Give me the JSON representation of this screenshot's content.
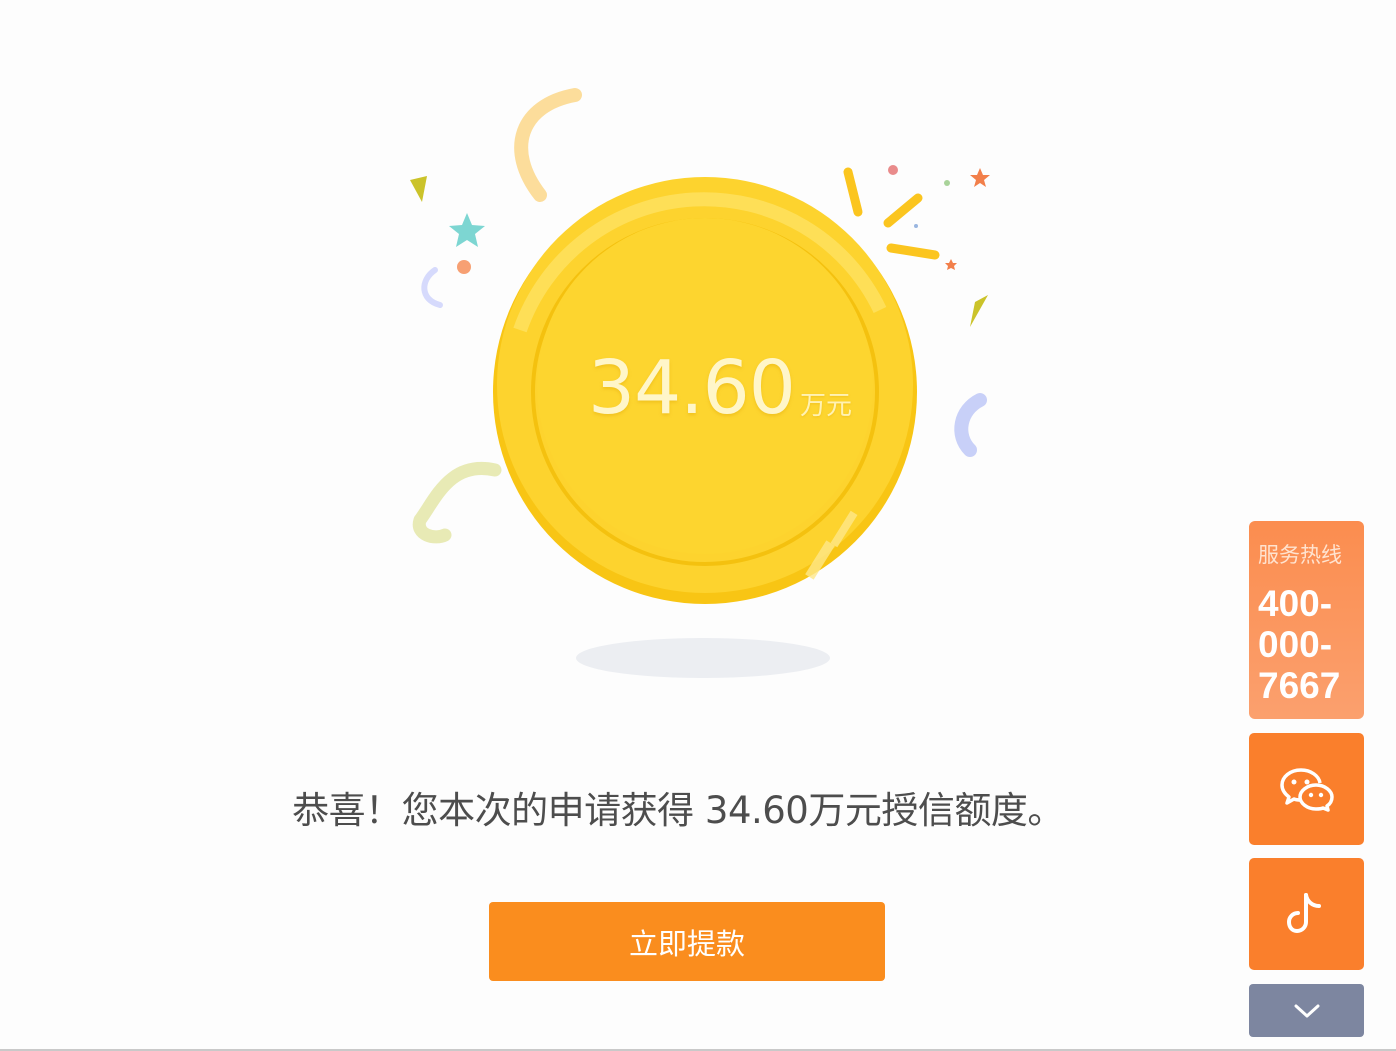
{
  "hero": {
    "amount": "34.60",
    "unit": "万元"
  },
  "message": "恭喜！您本次的申请获得 34.60万元授信额度。",
  "actions": {
    "withdraw_label": "立即提款"
  },
  "sidebar": {
    "hotline_label": "服务热线",
    "hotline_lines": [
      "400-",
      "000-",
      "7667"
    ],
    "icons": [
      "wechat-icon",
      "tiktok-icon",
      "chevron-down-icon"
    ]
  },
  "colors": {
    "coin": "#fdd32e",
    "coin_rim": "#f8c514",
    "button": "#fa8d1e",
    "sidebar_orange": "#fa7f2c",
    "sidebar_gray": "#7d86a0",
    "text": "#4d4d4d"
  }
}
